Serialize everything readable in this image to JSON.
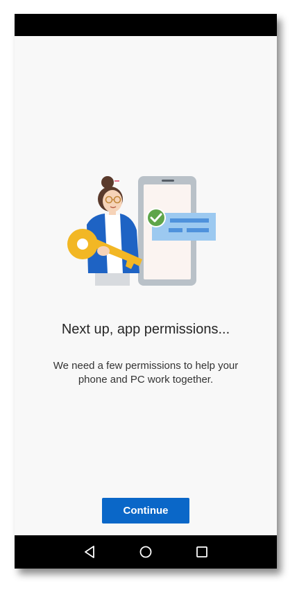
{
  "screen": {
    "title": "Next up, app permissions...",
    "description": "We need a few permissions to help your phone and PC work together.",
    "continue_label": "Continue"
  },
  "illustration": {
    "name": "permissions-illustration",
    "colors": {
      "key": "#f2b724",
      "jacket": "#1e63c4",
      "phone_frame": "#b9c1c8",
      "card": "#9cc9f0",
      "check": "#5fa54a"
    }
  },
  "navigation": {
    "back_icon": "back-triangle-icon",
    "home_icon": "home-circle-icon",
    "recent_icon": "recent-apps-square-icon"
  },
  "colors": {
    "accent": "#0a67c8",
    "background": "#f8f8f8",
    "bars": "#000000"
  }
}
